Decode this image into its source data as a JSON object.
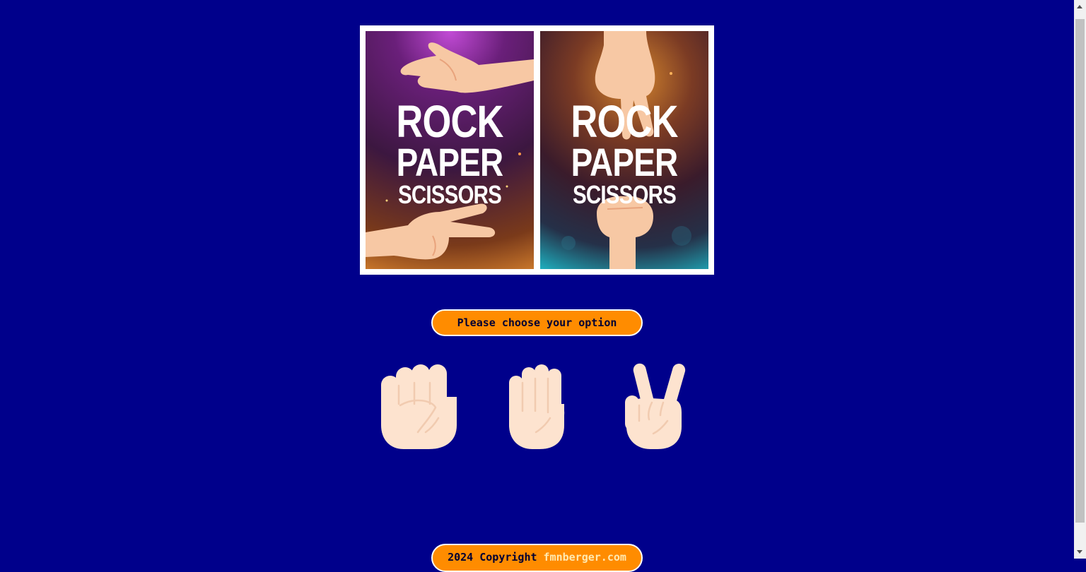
{
  "poster": {
    "left": {
      "line1": "ROCK",
      "line2": "PAPER",
      "line3": "SCISSORS"
    },
    "right": {
      "line1": "ROCK",
      "line2": "PAPER",
      "line3": "SCISSORS"
    }
  },
  "prompt_label": "Please choose your option",
  "choices": [
    {
      "name": "rock",
      "icon": "raised-fist-icon"
    },
    {
      "name": "paper",
      "icon": "raised-hand-icon"
    },
    {
      "name": "scissors",
      "icon": "victory-hand-icon"
    }
  ],
  "footer": {
    "copyright": "2024 Copyright",
    "link": "fmnberger.com"
  },
  "colors": {
    "background": "#00008b",
    "accent": "#ff8c00",
    "skin": "#fde3cf"
  }
}
